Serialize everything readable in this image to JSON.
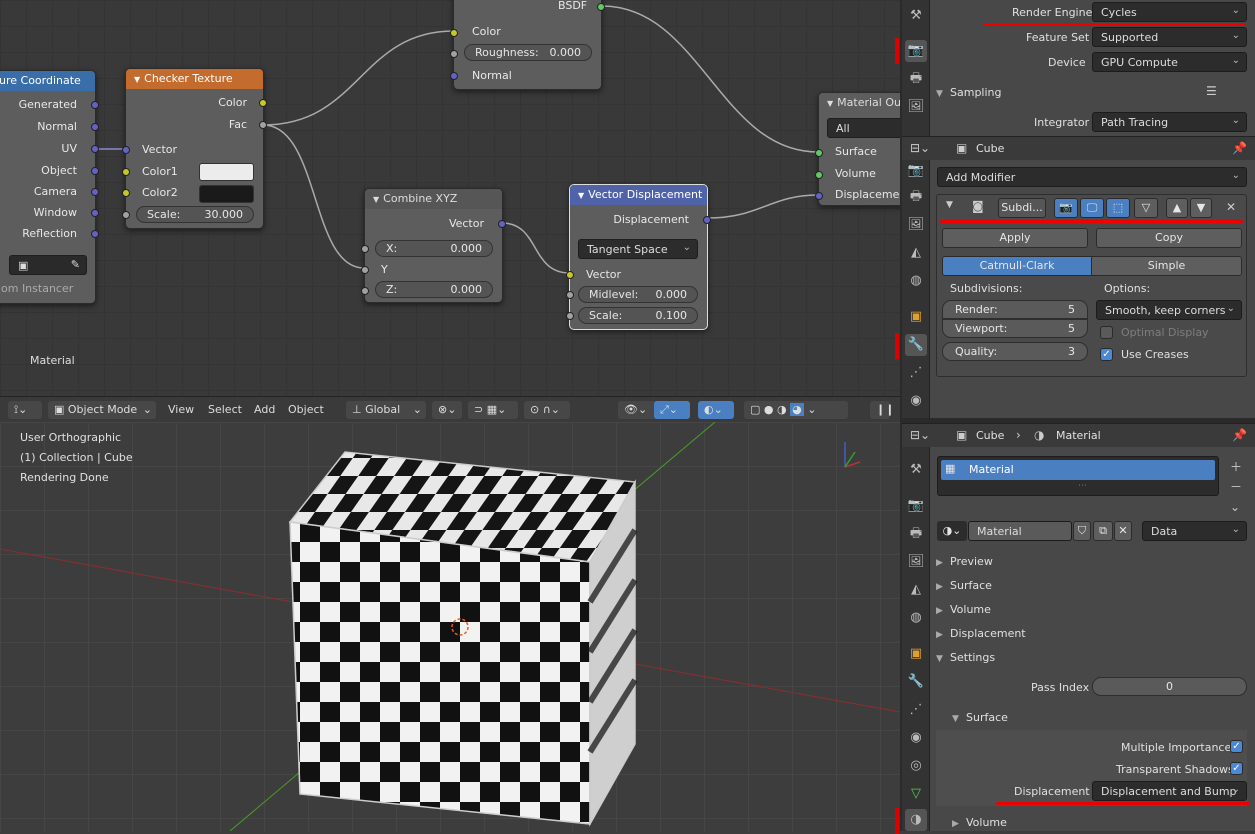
{
  "node_editor": {
    "frame_label": "Material",
    "tex_coord": {
      "title": "ure Coordinate",
      "outputs": [
        "Generated",
        "Normal",
        "UV",
        "Object",
        "Camera",
        "Window",
        "Reflection"
      ],
      "footer": "om Instancer"
    },
    "checker": {
      "title": "Checker Texture",
      "out_color": "Color",
      "out_fac": "Fac",
      "in_vector": "Vector",
      "color1": "Color1",
      "color2": "Color2",
      "color1_hex": "#ececec",
      "color2_hex": "#1a1a1a",
      "scale_label": "Scale:",
      "scale_value": "30.000"
    },
    "bsdf": {
      "title": "BSDF",
      "color": "Color",
      "roughness_label": "Roughness:",
      "roughness_value": "0.000",
      "normal": "Normal"
    },
    "combine": {
      "title": "Combine XYZ",
      "out_vector": "Vector",
      "x_label": "X:",
      "x_value": "0.000",
      "y_label": "Y",
      "z_label": "Z:",
      "z_value": "0.000"
    },
    "vdisp": {
      "title": "Vector Displacement",
      "out": "Displacement",
      "space": "Tangent Space",
      "in_vector": "Vector",
      "midlevel_label": "Midlevel:",
      "midlevel_value": "0.000",
      "scale_label": "Scale:",
      "scale_value": "0.100"
    },
    "output": {
      "title": "Material Ou",
      "target": "All",
      "surface": "Surface",
      "volume": "Volume",
      "displacement": "Displaceme"
    }
  },
  "viewport_header": {
    "mode": "Object Mode",
    "menus": [
      "View",
      "Select",
      "Add",
      "Object"
    ],
    "orientation": "Global"
  },
  "viewport": {
    "view": "User Orthographic",
    "collection": "(1) Collection | Cube",
    "status": "Rendering Done"
  },
  "render_panel": {
    "engine_label": "Render Engine",
    "engine": "Cycles",
    "feature_label": "Feature Set",
    "feature": "Supported",
    "device_label": "Device",
    "device": "GPU Compute",
    "sampling": "Sampling",
    "integrator_label": "Integrator",
    "integrator": "Path Tracing"
  },
  "modifier_panel": {
    "object": "Cube",
    "add_modifier": "Add Modifier",
    "mod_name": "Subdi...",
    "apply": "Apply",
    "copy": "Copy",
    "catmull": "Catmull-Clark",
    "simple": "Simple",
    "subdivisions": "Subdivisions:",
    "options": "Options:",
    "render_label": "Render:",
    "render_value": "5",
    "viewport_label": "Viewport:",
    "viewport_value": "5",
    "quality_label": "Quality:",
    "quality_value": "3",
    "uv_smooth": "Smooth, keep corners",
    "optimal": "Optimal Display",
    "creases": "Use Creases"
  },
  "material_panel": {
    "object": "Cube",
    "material": "Material",
    "slot": "Material",
    "mat_field": "Material",
    "link": "Data",
    "sections": [
      "Preview",
      "Surface",
      "Volume",
      "Displacement",
      "Settings"
    ],
    "pass_label": "Pass Index",
    "pass_value": "0",
    "surface_sub": "Surface",
    "multiple_importance": "Multiple Importance",
    "transparent_shadows": "Transparent Shadows",
    "displacement_label": "Displacement",
    "displacement_value": "Displacement and Bump",
    "volume_sub": "Volume"
  }
}
